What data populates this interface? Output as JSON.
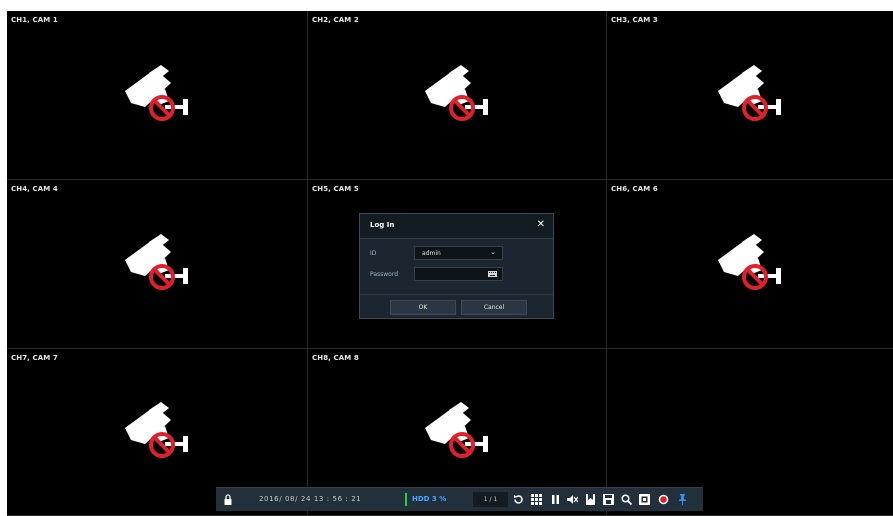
{
  "cameras": [
    {
      "label": "CH1, CAM 1"
    },
    {
      "label": "CH2, CAM 2"
    },
    {
      "label": "CH3, CAM 3"
    },
    {
      "label": "CH4, CAM 4"
    },
    {
      "label": "CH5, CAM 5"
    },
    {
      "label": "CH6, CAM 6"
    },
    {
      "label": "CH7, CAM 7"
    },
    {
      "label": "CH8, CAM 8"
    },
    {
      "label": ""
    }
  ],
  "login": {
    "title": "Log In",
    "id_label": "ID",
    "id_value": "admin",
    "password_label": "Password",
    "password_value": "",
    "ok_label": "OK",
    "cancel_label": "Cancel"
  },
  "toolbar": {
    "datetime": "2016/ 08/ 24  13 : 56 : 21",
    "hdd": "HDD  3 %",
    "page": "1 / 1",
    "icons": [
      "lock-icon",
      "sequence-icon",
      "layout-icon",
      "pause-icon",
      "mute-icon",
      "bookmark-icon",
      "save-icon",
      "search-icon",
      "export-icon",
      "record-icon",
      "pin-icon"
    ]
  },
  "colors": {
    "toolbar_bg": "#22303b",
    "hdd_text": "#4aa6ff",
    "hdd_bar": "#31c94a",
    "record": "#e0202a",
    "no_video_red": "#e0202a"
  }
}
